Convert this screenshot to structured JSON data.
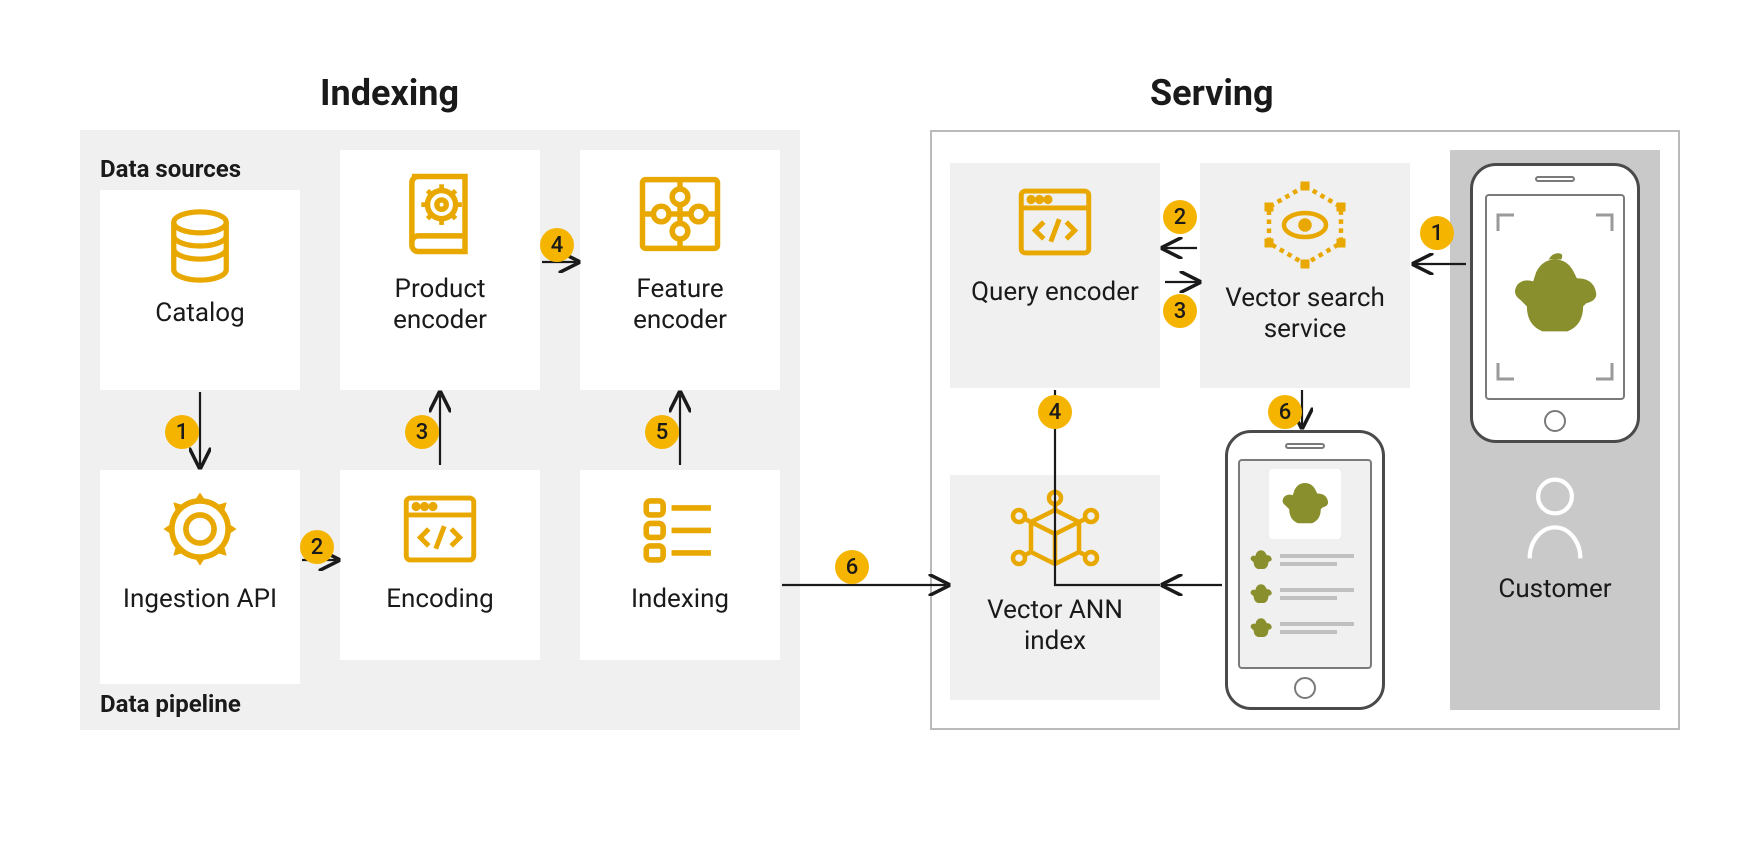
{
  "sections": {
    "indexing": "Indexing",
    "serving": "Serving"
  },
  "sublabels": {
    "data_sources": "Data sources",
    "data_pipeline": "Data pipeline"
  },
  "nodes": {
    "catalog": "Catalog",
    "product_encoder": "Product encoder",
    "feature_encoder": "Feature encoder",
    "ingestion_api": "Ingestion API",
    "encoding": "Encoding",
    "indexing": "Indexing",
    "query_encoder": "Query encoder",
    "vector_search_service": "Vector search service",
    "vector_ann_index": "Vector ANN index",
    "customer": "Customer"
  },
  "badges": {
    "idx1": "1",
    "idx2": "2",
    "idx3": "3",
    "idx4": "4",
    "idx5": "5",
    "idx6": "6",
    "srv1": "1",
    "srv2": "2",
    "srv3": "3",
    "srv4": "4",
    "srv6": "6"
  },
  "colors": {
    "accent": "#e8a800",
    "badge": "#f5b400",
    "olive": "#8a8f2e"
  }
}
